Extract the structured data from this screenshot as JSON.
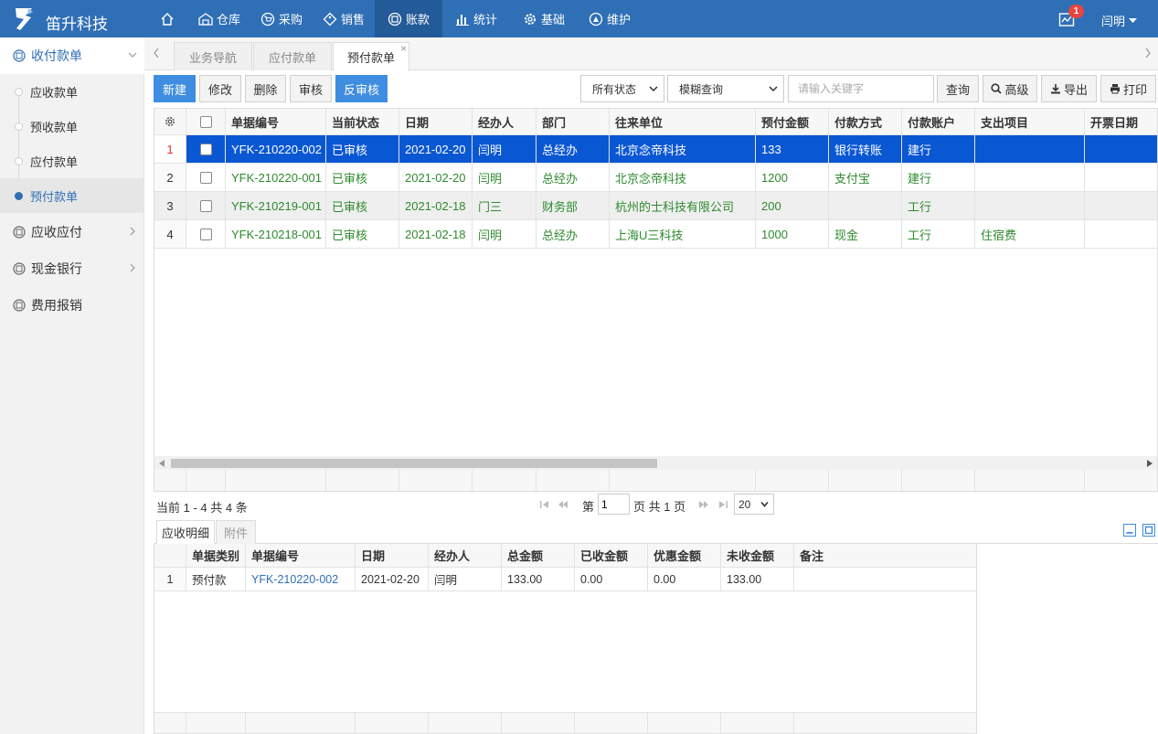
{
  "app": {
    "brand": "笛升科技"
  },
  "topnav": [
    {
      "label": "",
      "icon": "home-icon"
    },
    {
      "label": "仓库",
      "icon": "warehouse-icon"
    },
    {
      "label": "采购",
      "icon": "cart-icon"
    },
    {
      "label": "销售",
      "icon": "tag-icon"
    },
    {
      "label": "账款",
      "icon": "money-icon",
      "active": true
    },
    {
      "label": "统计",
      "icon": "bar-chart-icon"
    },
    {
      "label": "基础",
      "icon": "gear-icon"
    },
    {
      "label": "维护",
      "icon": "maintenance-icon"
    }
  ],
  "header": {
    "notify_count": "1",
    "user": "闫明"
  },
  "sidebar": {
    "groups": [
      {
        "label": "收付款单",
        "expanded": true
      },
      {
        "label": "应收应付"
      },
      {
        "label": "现金银行"
      },
      {
        "label": "费用报销"
      }
    ],
    "sub_items": [
      {
        "label": "应收款单"
      },
      {
        "label": "预收款单"
      },
      {
        "label": "应付款单"
      },
      {
        "label": "预付款单",
        "active": true
      }
    ]
  },
  "tabs": [
    {
      "label": "业务导航"
    },
    {
      "label": "应付款单"
    },
    {
      "label": "预付款单",
      "active": true
    }
  ],
  "tab_close": "×",
  "toolbar": {
    "buttons": [
      "新建",
      "修改",
      "删除",
      "审核",
      "反审核"
    ],
    "status_select": "所有状态",
    "query_mode_select": "模糊查询",
    "search_placeholder": "请输入关键字",
    "query": "查询",
    "advanced": "高级",
    "export": "导出",
    "print": "打印"
  },
  "grid": {
    "columns": [
      "单据编号",
      "当前状态",
      "日期",
      "经办人",
      "部门",
      "往来单位",
      "预付金额",
      "付款方式",
      "付款账户",
      "支出项目",
      "开票日期"
    ],
    "rows": [
      {
        "n": "1",
        "id": "YFK-210220-002",
        "status": "已审核",
        "date": "2021-02-20",
        "handler": "闫明",
        "dept": "总经办",
        "partner": "北京念帝科技",
        "amount": "133",
        "pay_method": "银行转账",
        "account": "建行",
        "expense": "",
        "invoice_date": ""
      },
      {
        "n": "2",
        "id": "YFK-210220-001",
        "status": "已审核",
        "date": "2021-02-20",
        "handler": "闫明",
        "dept": "总经办",
        "partner": "北京念帝科技",
        "amount": "1200",
        "pay_method": "支付宝",
        "account": "建行",
        "expense": "",
        "invoice_date": ""
      },
      {
        "n": "3",
        "id": "YFK-210219-001",
        "status": "已审核",
        "date": "2021-02-18",
        "handler": "门三",
        "dept": "财务部",
        "partner": "杭州的士科技有限公司",
        "amount": "200",
        "pay_method": "",
        "account": "工行",
        "expense": "",
        "invoice_date": ""
      },
      {
        "n": "4",
        "id": "YFK-210218-001",
        "status": "已审核",
        "date": "2021-02-18",
        "handler": "闫明",
        "dept": "总经办",
        "partner": "上海U三科技",
        "amount": "1000",
        "pay_method": "现金",
        "account": "工行",
        "expense": "住宿费",
        "invoice_date": ""
      }
    ],
    "selected_row": 1
  },
  "pager": {
    "info": "当前 1 - 4 共 4 条",
    "page_prefix": "第",
    "page": "1",
    "page_suffix": "页 共 1 页",
    "page_size": "20"
  },
  "detail": {
    "tabs": [
      "应收明细",
      "附件"
    ],
    "columns": [
      "单据类别",
      "单据编号",
      "日期",
      "经办人",
      "总金额",
      "已收金额",
      "优惠金额",
      "未收金额",
      "备注"
    ],
    "rows": [
      {
        "n": "1",
        "type": "预付款",
        "id": "YFK-210220-002",
        "date": "2021-02-20",
        "handler": "闫明",
        "total": "133.00",
        "received": "0.00",
        "discount": "0.00",
        "unreceived": "133.00",
        "remark": ""
      }
    ]
  }
}
